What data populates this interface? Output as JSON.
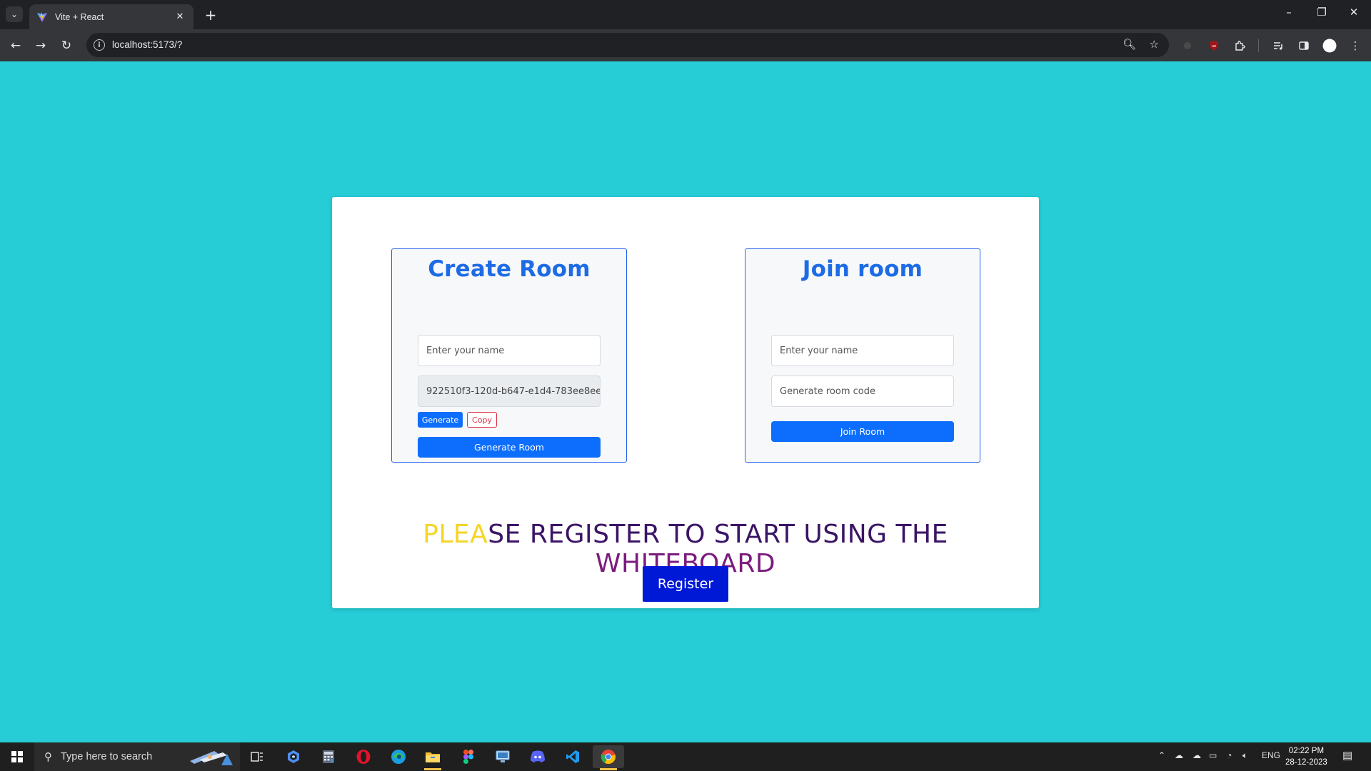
{
  "browser": {
    "tab_title": "Vite + React",
    "url": "localhost:5173/?"
  },
  "create_room": {
    "title": "Create Room",
    "name_placeholder": "Enter your name",
    "room_code_value": "922510f3-120d-b647-e1d4-783ee8ee",
    "generate_label": "Generate",
    "copy_label": "Copy",
    "submit_label": "Generate Room"
  },
  "join_room": {
    "title": "Join room",
    "name_placeholder": "Enter your name",
    "code_placeholder": "Generate room code",
    "submit_label": "Join Room"
  },
  "register": {
    "text_part1": "PLEA",
    "text_part2": "SE REGISTER TO START USING THE ",
    "text_part3": "WHITEBOARD",
    "button_label": "Register"
  },
  "taskbar": {
    "search_placeholder": "Type here to search",
    "language": "ENG",
    "time": "02:22 PM",
    "date": "28-12-2023"
  },
  "colors": {
    "page_background": "#26ccd6",
    "panel_title": "#1d6be5",
    "primary_button": "#0d6efd",
    "register_button": "#0019d6",
    "text_yellow": "#f5d527",
    "text_indigo": "#3b1466",
    "text_purple": "#7b1c7d"
  }
}
